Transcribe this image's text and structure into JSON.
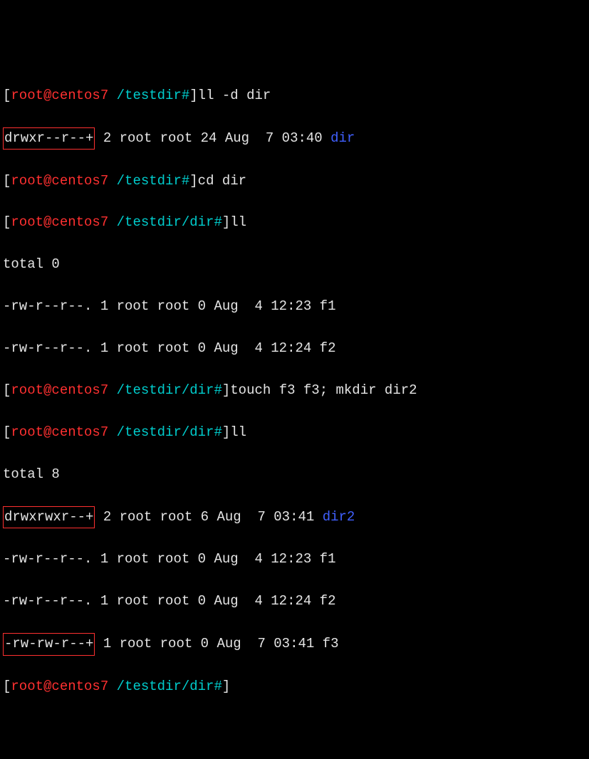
{
  "prompt": {
    "bracket_open": "[",
    "user_host": "root@centos7",
    "path1": " /testdir#",
    "path2": " /testdir/dir#",
    "bracket_close": "]"
  },
  "cmd": {
    "ll_d_dir": "ll -d dir",
    "cd_dir": "cd dir",
    "ll": "ll",
    "touch_mkdir": "touch f3 f3; mkdir dir2"
  },
  "out": {
    "drwxr_plus": "drwxr--r--+",
    "dir_meta": " 2 root root 24 Aug  7 03:40 ",
    "dir_name": "dir",
    "total0": "total 0",
    "f1_line": "-rw-r--r--. 1 root root 0 Aug  4 12:23 f1",
    "f2_line": "-rw-r--r--. 1 root root 0 Aug  4 12:24 f2",
    "total8": "total 8",
    "drwxrwxr_plus": "drwxrwxr--+",
    "dir2_meta": " 2 root root 6 Aug  7 03:41 ",
    "dir2_name": "dir2",
    "f1b_line": "-rw-r--r--. 1 root root 0 Aug  4 12:23 f1",
    "f2b_line": "-rw-r--r--. 1 root root 0 Aug  4 12:24 f2",
    "f3_perm": "-rw-rw-r--+",
    "f3_meta": " 1 root root 0 Aug  7 03:41 f3"
  }
}
